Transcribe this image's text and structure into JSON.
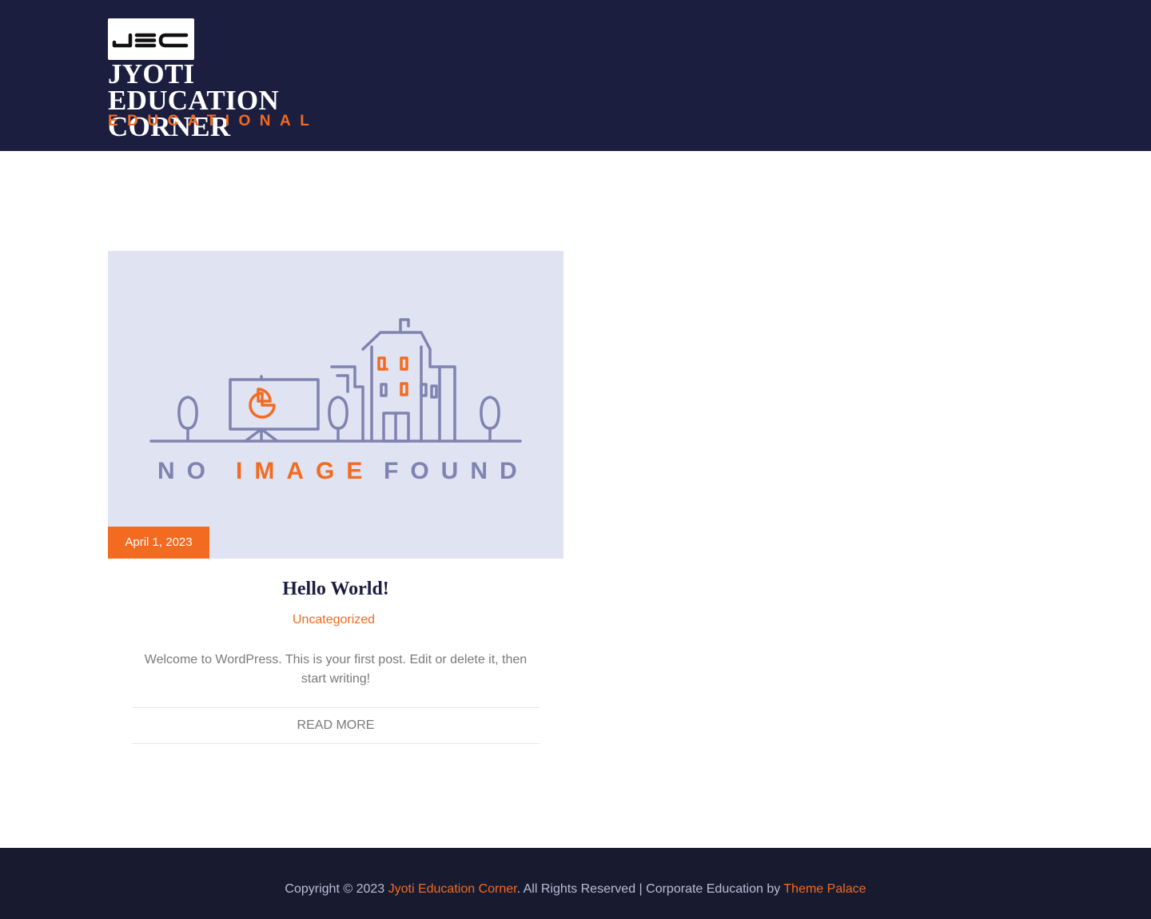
{
  "header": {
    "logo_alt": "JEC",
    "site_title": "Jyoti Education Corner",
    "tagline": "Educational"
  },
  "post": {
    "thumbnail_text_1": "NO",
    "thumbnail_text_2": "IMAGE",
    "thumbnail_text_3": "FOUND",
    "date": "April 1, 2023",
    "title": "Hello World!",
    "category": "Uncategorized",
    "excerpt": "Welcome to WordPress. This is your first post. Edit or delete it, then start writing!",
    "read_more": "Read More"
  },
  "footer": {
    "copyright_prefix": "Copyright © 2023",
    "site_link": "Jyoti Education Corner",
    "rights_text": ". All Rights Reserved | Corporate Education by",
    "theme_link": "Theme Palace"
  },
  "colors": {
    "header_bg": "#1c1e40",
    "accent": "#f26b21",
    "footer_bg": "#181a30",
    "thumbnail_bg": "#e0e3f2",
    "thumbnail_line": "#7f83b0"
  }
}
